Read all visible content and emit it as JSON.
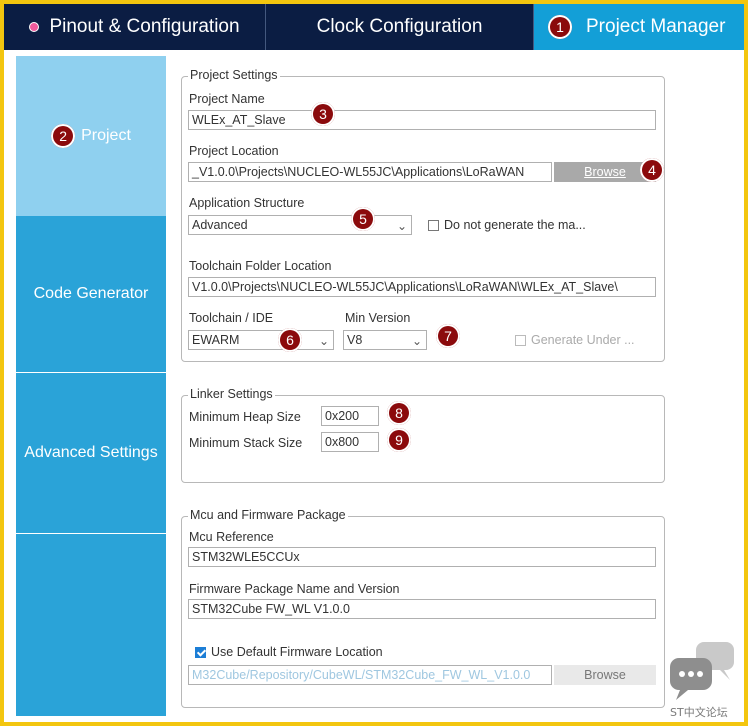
{
  "tabs": {
    "pinout": "Pinout & Configuration",
    "clock": "Clock Configuration",
    "project_manager": "Project Manager",
    "project_manager_badge": "1"
  },
  "nav": {
    "project": "Project",
    "project_badge": "2",
    "code_generator": "Code Generator",
    "advanced_settings": "Advanced Settings"
  },
  "project_settings": {
    "legend": "Project Settings",
    "name_label": "Project Name",
    "name_value": "WLEx_AT_Slave",
    "name_badge": "3",
    "location_label": "Project Location",
    "location_value": "_V1.0.0\\Projects\\NUCLEO-WL55JC\\Applications\\LoRaWAN",
    "browse_label": "Browse",
    "browse_badge": "4",
    "app_structure_label": "Application Structure",
    "app_structure_value": "Advanced",
    "app_structure_badge": "5",
    "do_not_generate_label": "Do not generate the ma...",
    "toolchain_folder_label": "Toolchain Folder Location",
    "toolchain_folder_value": "V1.0.0\\Projects\\NUCLEO-WL55JC\\Applications\\LoRaWAN\\WLEx_AT_Slave\\",
    "toolchain_ide_label": "Toolchain / IDE",
    "toolchain_ide_value": "EWARM",
    "toolchain_ide_badge": "6",
    "min_version_label": "Min Version",
    "min_version_value": "V8",
    "min_version_badge": "7",
    "generate_under_label": "Generate Under ..."
  },
  "linker_settings": {
    "legend": "Linker Settings",
    "heap_label": "Minimum Heap Size",
    "heap_value": "0x200",
    "heap_badge": "8",
    "stack_label": "Minimum Stack Size",
    "stack_value": "0x800",
    "stack_badge": "9"
  },
  "mcu_firmware": {
    "legend": "Mcu and Firmware Package",
    "mcu_ref_label": "Mcu Reference",
    "mcu_ref_value": "STM32WLE5CCUx",
    "fw_name_label": "Firmware Package Name and Version",
    "fw_name_value": "STM32Cube FW_WL V1.0.0",
    "use_default_label": "Use Default Firmware Location",
    "fw_location_value": "M32Cube/Repository/CubeWL/STM32Cube_FW_WL_V1.0.0",
    "browse_label": "Browse"
  },
  "watermark": {
    "text": "ST中文论坛"
  },
  "colors": {
    "dark_tab": "#0b1d43",
    "accent": "#139fd7",
    "nav": "#2aa3d8",
    "nav_active": "#8fd0ef",
    "badge": "#8b0a0c",
    "frame": "#f3c60f"
  }
}
